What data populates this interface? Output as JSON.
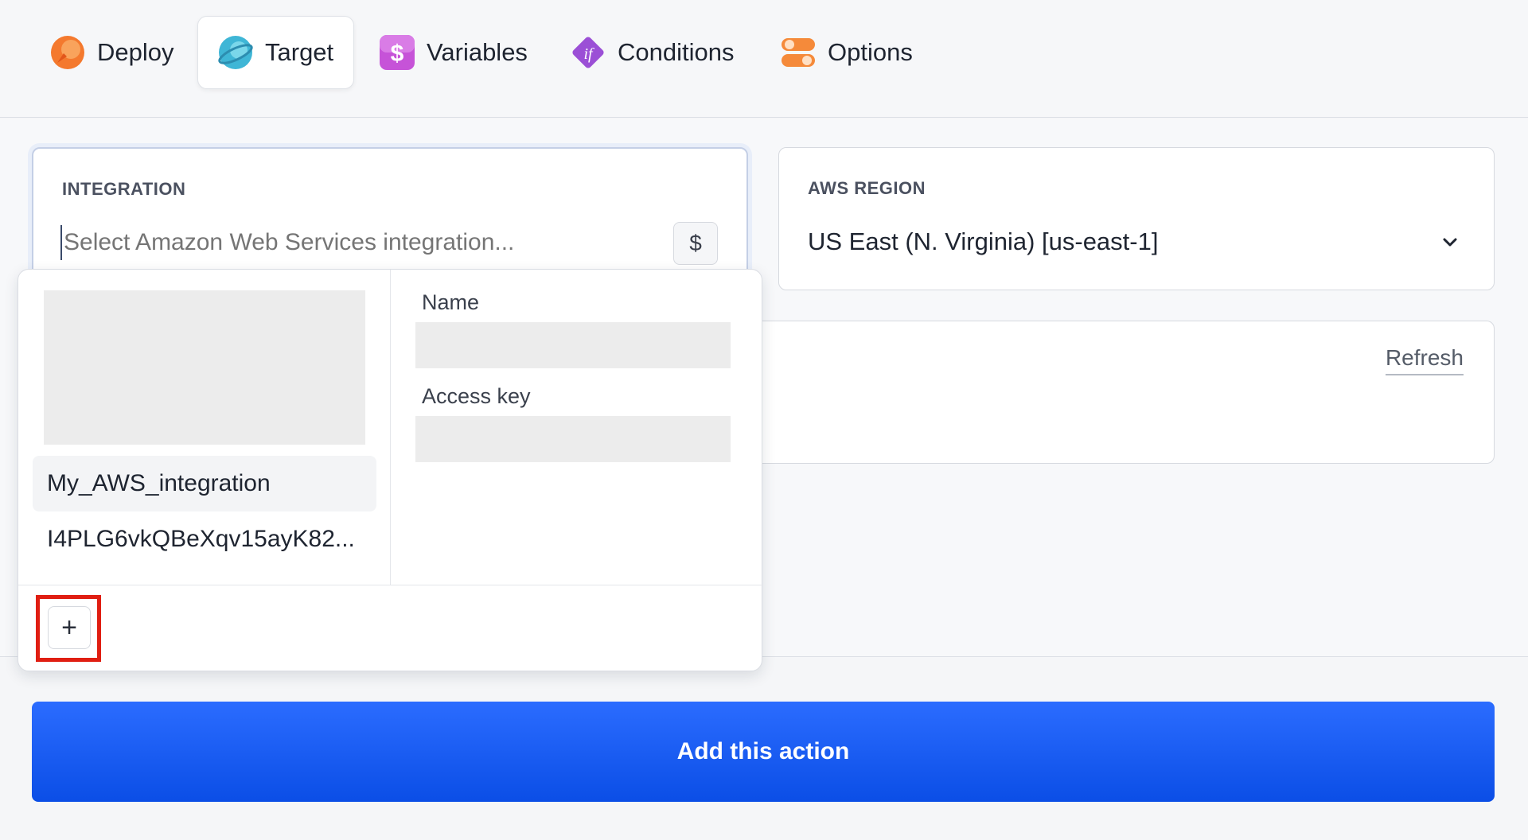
{
  "tabs": [
    {
      "label": "Deploy",
      "icon": "rocket-icon",
      "active": false
    },
    {
      "label": "Target",
      "icon": "globe-icon",
      "active": true
    },
    {
      "label": "Variables",
      "icon": "dollar-icon",
      "active": false
    },
    {
      "label": "Conditions",
      "icon": "if-icon",
      "active": false
    },
    {
      "label": "Options",
      "icon": "toggles-icon",
      "active": false
    }
  ],
  "integration": {
    "label": "INTEGRATION",
    "placeholder": "Select Amazon Web Services integration...",
    "variable_button": "$"
  },
  "region": {
    "label": "AWS REGION",
    "value": "US East (N. Virginia) [us-east-1]"
  },
  "bucket": {
    "refresh_label": "Refresh"
  },
  "dropdown": {
    "items": [
      {
        "label": "My_AWS_integration",
        "selected": true
      },
      {
        "label": "I4PLG6vkQBeXqv15ayK82...",
        "selected": false
      }
    ],
    "details": {
      "name_label": "Name",
      "access_key_label": "Access key"
    },
    "add_button": "+"
  },
  "footer": {
    "add_action_label": "Add this action"
  },
  "colors": {
    "primary": "#1a5ef5",
    "highlight": "#e01e12"
  }
}
